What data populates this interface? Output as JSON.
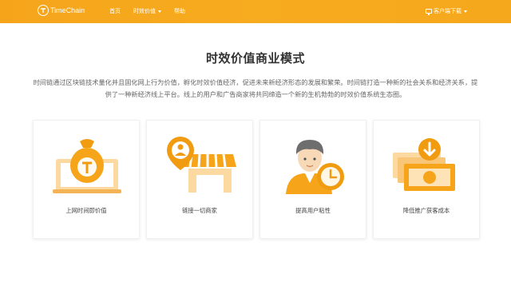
{
  "header": {
    "logo_text": "TimeChain",
    "nav": [
      {
        "label": "首页"
      },
      {
        "label": "时效价值"
      },
      {
        "label": "帮助"
      }
    ],
    "download_label": "客户端下载"
  },
  "main": {
    "title": "时效价值商业模式",
    "intro": "时间链通过区块链技术量化并且固化网上行为价值，孵化时效价值经济，促进未来新经济形态的发展和繁荣。时间链打造一种新的社会关系和经济关系，提供了一种新经济线上平台。线上的用户和广告商家将共同缔造一个新的生机勃勃的时效价值系统生态圈。",
    "cards": [
      {
        "label": "上网时间即价值",
        "icon": "money-bag-laptop-icon"
      },
      {
        "label": "链接一切商家",
        "icon": "store-user-pin-icon"
      },
      {
        "label": "提高用户粘性",
        "icon": "user-clock-icon"
      },
      {
        "label": "降低推广获客成本",
        "icon": "banknotes-download-icon"
      }
    ]
  },
  "colors": {
    "brand": "#f6a51b",
    "icon_dark": "#f09b10",
    "icon_light": "#fcd9a1"
  }
}
